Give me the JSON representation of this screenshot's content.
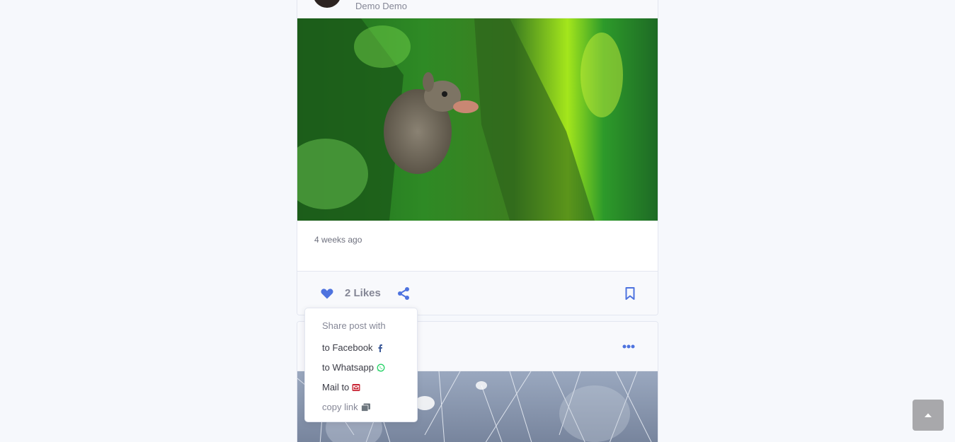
{
  "post1": {
    "author": "Demo Demo",
    "timestamp": "4 weeks ago",
    "likes_label": "2 Likes"
  },
  "share_menu": {
    "header": "Share post with",
    "items": [
      {
        "label": "to Facebook",
        "icon": "facebook-icon",
        "color": "#3b5998"
      },
      {
        "label": "to Whatsapp",
        "icon": "whatsapp-icon",
        "color": "#25d366"
      },
      {
        "label": "Mail to",
        "icon": "envelope-icon",
        "color": "#c82333"
      },
      {
        "label": "copy link",
        "icon": "copy-icon",
        "color": "#6c757d"
      }
    ]
  },
  "colors": {
    "accent": "#4e73df",
    "page_background": "#f6f8fc"
  },
  "icons": {
    "like": "heart-icon",
    "share": "share-icon",
    "bookmark": "bookmark-icon",
    "more": "ellipsis-icon",
    "scroll_top": "chevron-up-icon"
  }
}
